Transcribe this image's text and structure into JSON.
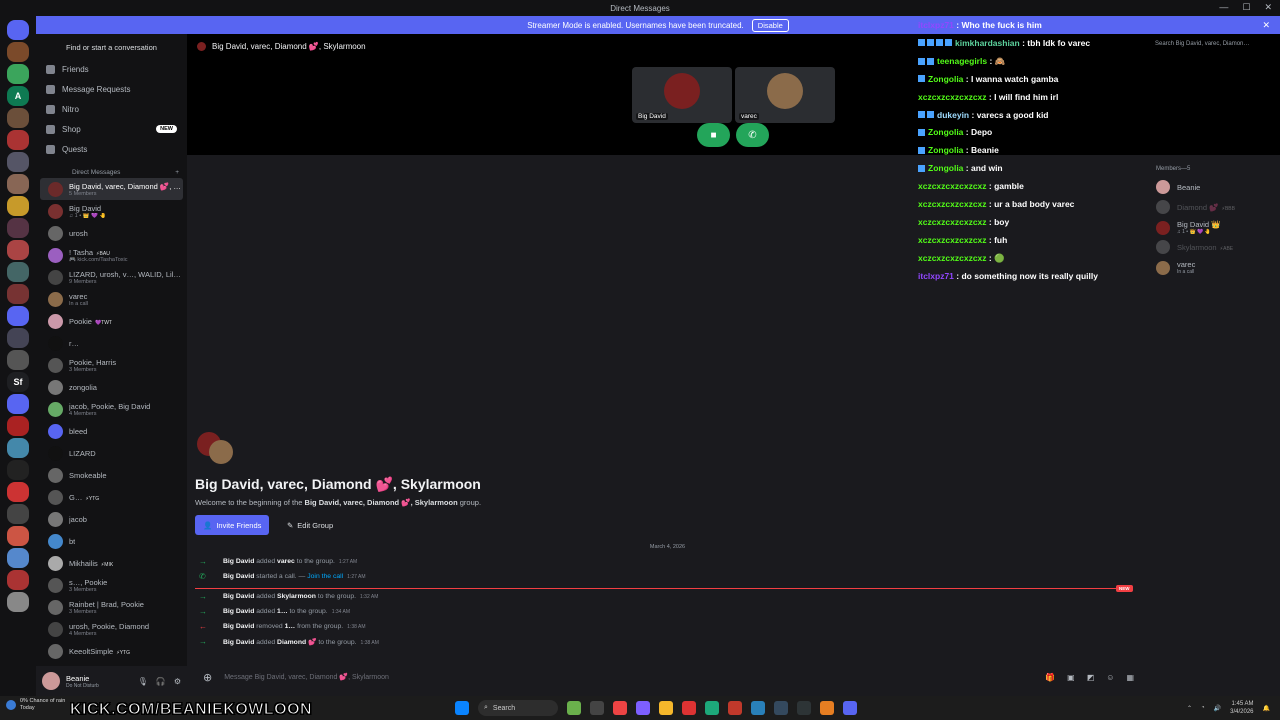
{
  "window": {
    "title": "Direct Messages"
  },
  "banner": {
    "text": "Streamer Mode is enabled. Usernames have been truncated.",
    "button": "Disable"
  },
  "servers": [
    {
      "label": "",
      "color": "#5865f2"
    },
    {
      "label": "",
      "color": "#7b4a2a"
    },
    {
      "label": "",
      "color": "#3ba55c"
    },
    {
      "label": "A",
      "color": "#0e7a52"
    },
    {
      "label": "",
      "color": "#6b4f3a"
    },
    {
      "label": "",
      "color": "#a33"
    },
    {
      "label": "",
      "color": "#556"
    },
    {
      "label": "",
      "color": "#865"
    },
    {
      "label": "",
      "color": "#c79a2a"
    },
    {
      "label": "",
      "color": "#534"
    },
    {
      "label": "",
      "color": "#a44"
    },
    {
      "label": "",
      "color": "#466"
    },
    {
      "label": "",
      "color": "#733"
    },
    {
      "label": "",
      "color": "#5865f2"
    },
    {
      "label": "",
      "color": "#445"
    },
    {
      "label": "",
      "color": "#555"
    },
    {
      "label": "Sf",
      "color": "#1e1f22"
    },
    {
      "label": "",
      "color": "#5865f2"
    },
    {
      "label": "",
      "color": "#a22"
    },
    {
      "label": "",
      "color": "#48a"
    },
    {
      "label": "",
      "color": "#222"
    },
    {
      "label": "",
      "color": "#c33"
    },
    {
      "label": "",
      "color": "#444"
    },
    {
      "label": "",
      "color": "#c54"
    },
    {
      "label": "",
      "color": "#58c"
    },
    {
      "label": "",
      "color": "#a33"
    },
    {
      "label": "",
      "color": "#888"
    }
  ],
  "dm_sidebar": {
    "search": "Find or start a conversation",
    "nav": [
      {
        "label": "Friends"
      },
      {
        "label": "Message Requests"
      },
      {
        "label": "Nitro"
      },
      {
        "label": "Shop",
        "badge": "NEW"
      },
      {
        "label": "Quests"
      }
    ],
    "header": "Direct Messages",
    "items": [
      {
        "name": "Big David, varec, Diamond 💕, S…",
        "sub": "5 Members",
        "color": "#6b2a2a",
        "active": true
      },
      {
        "name": "Big David",
        "sub": "♫ 1 • 👑 💜 🤚",
        "color": "#7a3030"
      },
      {
        "name": "urosh",
        "sub": "",
        "color": "#666"
      },
      {
        "name": "! Tasha",
        "tag": "⚡BAU",
        "sub": "🎮 kick.com/TashaToxic",
        "color": "#9b5fc0"
      },
      {
        "name": "LIZARD, urosh, v…, WALID, Lile…",
        "sub": "9 Members",
        "color": "#444"
      },
      {
        "name": "varec",
        "sub": "In a call",
        "color": "#8b6b4a"
      },
      {
        "name": "Pookie",
        "tag": "💜TWT",
        "sub": "",
        "color": "#c9a"
      },
      {
        "name": "r…",
        "sub": "",
        "color": "#111"
      },
      {
        "name": "Pookie, Harris",
        "sub": "3 Members",
        "color": "#555"
      },
      {
        "name": "zongolia",
        "sub": "",
        "color": "#777"
      },
      {
        "name": "jacob, Pookie, Big David",
        "sub": "4 Members",
        "color": "#6a6"
      },
      {
        "name": "bleed",
        "sub": "",
        "color": "#5865f2"
      },
      {
        "name": "LIZARD",
        "sub": "",
        "color": "#111"
      },
      {
        "name": "Smokeable",
        "sub": "",
        "color": "#666"
      },
      {
        "name": "G…",
        "tag": "⚡YTG",
        "sub": "",
        "color": "#555"
      },
      {
        "name": "jacob",
        "sub": "",
        "color": "#777"
      },
      {
        "name": "bt",
        "sub": "",
        "color": "#48c"
      },
      {
        "name": "Mikhailis",
        "tag": "⚡MIK",
        "sub": "",
        "color": "#aaa"
      },
      {
        "name": "s…, Pookie",
        "sub": "3 Members",
        "color": "#555"
      },
      {
        "name": "Rainbet | Brad, Pookie",
        "sub": "3 Members",
        "color": "#666"
      },
      {
        "name": "urosh, Pookie, Diamond",
        "sub": "4 Members",
        "color": "#444"
      },
      {
        "name": "KeeoltSimple",
        "tag": "⚡YTG",
        "sub": "",
        "color": "#666"
      }
    ],
    "user": {
      "name": "Beanie",
      "status": "Do Not Disturb"
    }
  },
  "call": {
    "channel": "Big David, varec, Diamond 💕, Skylarmoon",
    "tiles": [
      {
        "label": "Big David",
        "color": "#7a2020"
      },
      {
        "label": "varec",
        "color": "#8b6b4a"
      }
    ]
  },
  "chat_intro": {
    "title": "Big David, varec, Diamond 💕, Skylarmoon",
    "welcome_pre": "Welcome to the beginning of the",
    "welcome_bold": "Big David, varec, Diamond 💕, Skylarmoon",
    "welcome_post": "group.",
    "invite": "Invite Friends",
    "edit": "Edit Group",
    "date": "March 4, 2026"
  },
  "system_messages": [
    {
      "arrow": "→",
      "color": "#23a55a",
      "actor": "Big David",
      "verb": "added",
      "target": "varec",
      "rest": "to the group.",
      "time": "1:27 AM"
    },
    {
      "arrow": "✆",
      "color": "#23a55a",
      "actor": "Big David",
      "verb": "started a call. —",
      "target": "",
      "rest": "Join the call",
      "time": "1:27 AM",
      "link": true
    },
    {
      "arrow": "→",
      "color": "#23a55a",
      "actor": "Big David",
      "verb": "added",
      "target": "Skylarmoon",
      "rest": "to the group.",
      "time": "1:32 AM"
    },
    {
      "arrow": "→",
      "color": "#23a55a",
      "actor": "Big David",
      "verb": "added",
      "target": "1…",
      "rest": "to the group.",
      "time": "1:34 AM"
    },
    {
      "arrow": "←",
      "color": "#f23f43",
      "actor": "Big David",
      "verb": "removed",
      "target": "1…",
      "rest": "from the group.",
      "time": "1:38 AM"
    },
    {
      "arrow": "→",
      "color": "#23a55a",
      "actor": "Big David",
      "verb": "added",
      "target": "Diamond 💕",
      "rest": "to the group.",
      "time": "1:38 AM"
    }
  ],
  "new_badge": "NEW",
  "composer": {
    "placeholder": "Message Big David, varec, Diamond 💕, Skylarmoon"
  },
  "top_search": "Search Big David, varec, Diamon…",
  "members": {
    "header": "Members—5",
    "list": [
      {
        "name": "Beanie",
        "sub": "",
        "color": "#c99",
        "dim": false
      },
      {
        "name": "Diamond 💕",
        "tag": "⚡BBB",
        "sub": "",
        "color": "#999",
        "dim": true
      },
      {
        "name": "Big David 👑",
        "sub": "♫ 1 • 👑 💜 🤚",
        "color": "#7a2020",
        "dim": false
      },
      {
        "name": "Skylarmoon",
        "tag": "⚡ABE",
        "sub": "",
        "color": "#999",
        "dim": true
      },
      {
        "name": "varec",
        "sub": "In a call",
        "color": "#8b6b4a",
        "dim": false
      }
    ]
  },
  "stream_chat": [
    {
      "user": "itclxpz71",
      "color": "#9147ff",
      "badges": 0,
      "msg": "Who the fuck is him"
    },
    {
      "user": "kimkhardashian",
      "color": "#5dd39e",
      "badges": 4,
      "msg": "tbh Idk fo varec"
    },
    {
      "user": "teenagegirls",
      "color": "#53fc18",
      "badges": 2,
      "msg": "🙈"
    },
    {
      "user": "Zongolia",
      "color": "#53fc18",
      "badges": 1,
      "msg": "I wanna watch gamba"
    },
    {
      "user": "xczcxzcxzcxzcxz",
      "color": "#53fc18",
      "badges": 0,
      "msg": "I will find him irl"
    },
    {
      "user": "dukeyin",
      "color": "#9fdcff",
      "badges": 2,
      "msg": "varecs a good kid"
    },
    {
      "user": "Zongolia",
      "color": "#53fc18",
      "badges": 1,
      "msg": "Depo"
    },
    {
      "user": "Zongolia",
      "color": "#53fc18",
      "badges": 1,
      "msg": "Beanie"
    },
    {
      "user": "Zongolia",
      "color": "#53fc18",
      "badges": 1,
      "msg": "and win"
    },
    {
      "user": "xczcxzcxzcxzcxz",
      "color": "#53fc18",
      "badges": 0,
      "msg": "gamble"
    },
    {
      "user": "xczcxzcxzcxzcxz",
      "color": "#53fc18",
      "badges": 0,
      "msg": "ur a bad body varec"
    },
    {
      "user": "xczcxzcxzcxzcxz",
      "color": "#53fc18",
      "badges": 0,
      "msg": "boy"
    },
    {
      "user": "xczcxzcxzcxzcxz",
      "color": "#53fc18",
      "badges": 0,
      "msg": "fuh"
    },
    {
      "user": "xczcxzcxzcxzcxz",
      "color": "#53fc18",
      "badges": 0,
      "msg": "🟢"
    },
    {
      "user": "itclxpz71",
      "color": "#9147ff",
      "badges": 0,
      "msg": "do something now its really quilly"
    }
  ],
  "taskbar": {
    "weather_temp": "0%",
    "weather_text": "Chance of rain",
    "weather_sub": "Today",
    "search": "Search",
    "time": "1:45 AM",
    "date": "3/4/2026",
    "overlay": "KICK.COM/BEANIEKOWLOON"
  }
}
